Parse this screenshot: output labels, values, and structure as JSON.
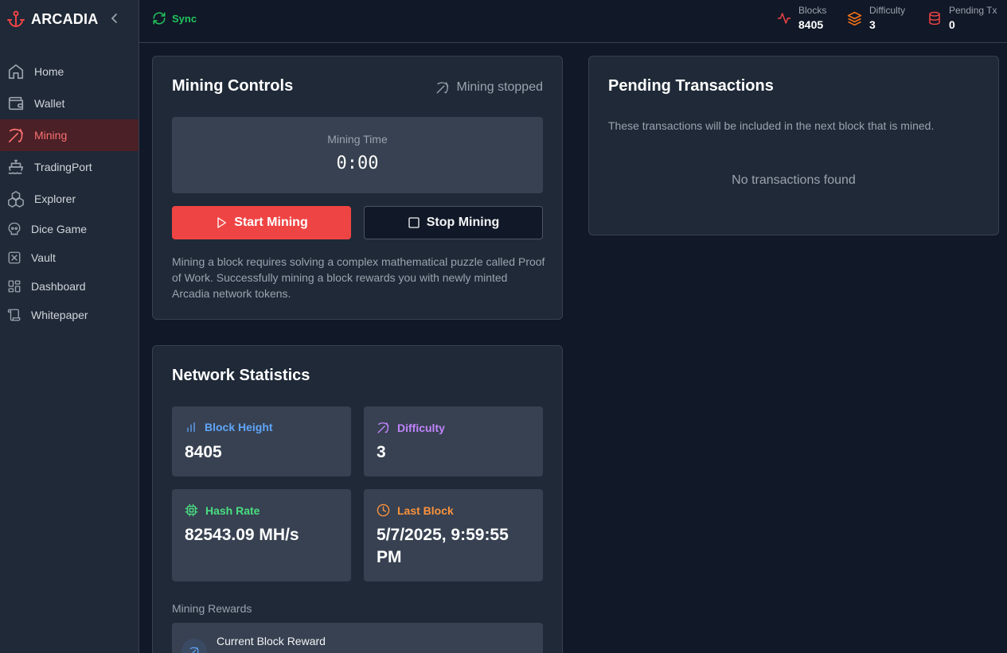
{
  "sidebar": {
    "brand": "ARCADIA",
    "items": [
      {
        "label": "Home",
        "icon": "home-icon"
      },
      {
        "label": "Wallet",
        "icon": "wallet-icon"
      },
      {
        "label": "Mining",
        "icon": "pickaxe-icon",
        "active": true
      },
      {
        "label": "TradingPort",
        "icon": "ship-icon"
      },
      {
        "label": "Explorer",
        "icon": "boxes-icon"
      },
      {
        "label": "Dice Game",
        "icon": "skull-icon"
      },
      {
        "label": "Vault",
        "icon": "square-x-icon"
      },
      {
        "label": "Dashboard",
        "icon": "layout-dashboard-icon"
      },
      {
        "label": "Whitepaper",
        "icon": "scroll-icon"
      }
    ]
  },
  "header": {
    "sync_label": "Sync",
    "stats": [
      {
        "label": "Blocks",
        "value": "8405",
        "icon": "activity-icon",
        "color": "#ef4444"
      },
      {
        "label": "Difficulty",
        "value": "3",
        "icon": "layers-icon",
        "color": "#f97316"
      },
      {
        "label": "Pending Tx",
        "value": "0",
        "icon": "database-icon",
        "color": "#ef4444"
      }
    ]
  },
  "mining_controls": {
    "title": "Mining Controls",
    "status": "Mining stopped",
    "timer_label": "Mining Time",
    "timer_value": "0:00",
    "start_label": "Start Mining",
    "stop_label": "Stop Mining",
    "description": "Mining a block requires solving a complex mathematical puzzle called Proof of Work. Successfully mining a block rewards you with newly minted Arcadia network tokens."
  },
  "pending": {
    "title": "Pending Transactions",
    "description": "These transactions will be included in the next block that is mined.",
    "empty": "No transactions found"
  },
  "network": {
    "title": "Network Statistics",
    "tiles": [
      {
        "label": "Block Height",
        "value": "8405",
        "color": "#60a5fa",
        "icon": "bar-chart-icon"
      },
      {
        "label": "Difficulty",
        "value": "3",
        "color": "#c084fc",
        "icon": "pickaxe-icon"
      },
      {
        "label": "Hash Rate",
        "value": "82543.09 MH/s",
        "color": "#4ade80",
        "icon": "cpu-icon"
      },
      {
        "label": "Last Block",
        "value": "5/7/2025, 9:59:55 PM",
        "color": "#fb923c",
        "icon": "clock-icon"
      }
    ],
    "rewards_label": "Mining Rewards",
    "reward_title": "Current Block Reward"
  },
  "colors": {
    "accent": "#ef4444",
    "bg": "#111827",
    "panel": "#1f2937",
    "tile": "#374151"
  }
}
